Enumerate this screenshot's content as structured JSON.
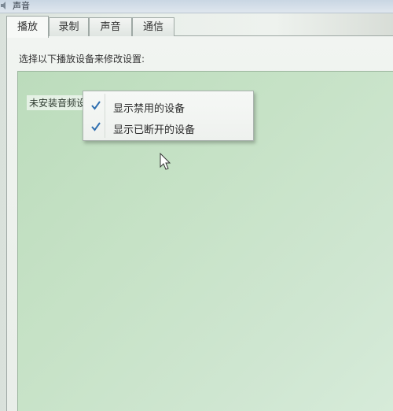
{
  "window": {
    "title": "声音"
  },
  "tabs": [
    {
      "label": "播放",
      "active": true
    },
    {
      "label": "录制",
      "active": false
    },
    {
      "label": "声音",
      "active": false
    },
    {
      "label": "通信",
      "active": false
    }
  ],
  "playback": {
    "instruction": "选择以下播放设备来修改设置:",
    "empty_state": "未安装音频设备"
  },
  "context_menu": {
    "items": [
      {
        "label": "显示禁用的设备",
        "checked": true
      },
      {
        "label": "显示已断开的设备",
        "checked": true
      }
    ]
  },
  "colors": {
    "list_background": "#c6e2c6",
    "check_color": "#2f6fb0"
  },
  "icons": {
    "title_icon": "speaker-icon",
    "menu_check": "checkmark-icon",
    "pointer": "mouse-cursor-icon"
  }
}
